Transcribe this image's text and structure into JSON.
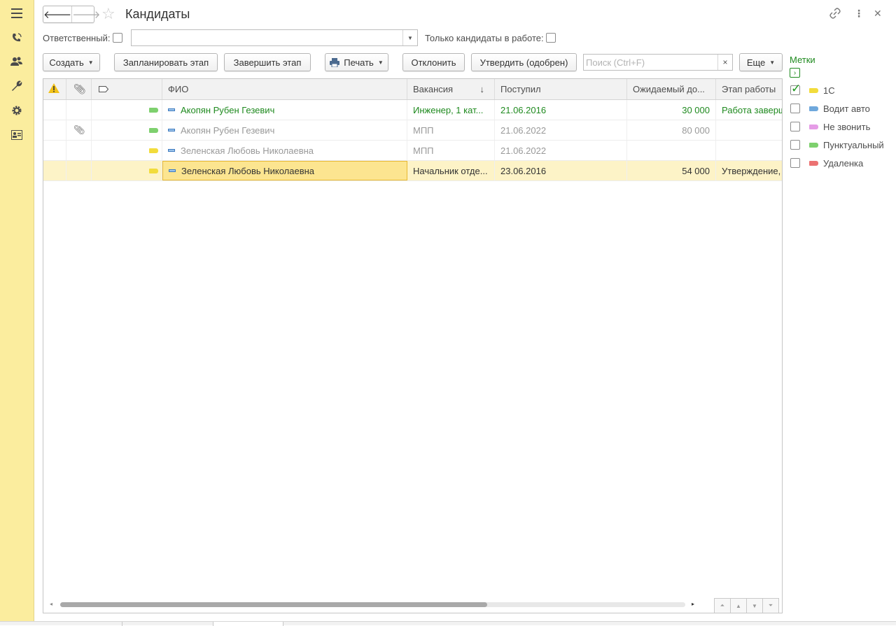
{
  "window": {
    "title": "Кандидаты"
  },
  "colors": {
    "tag_yellow": "#f2dc3c",
    "tag_blue": "#6fa8dc",
    "tag_pink": "#e59ce6",
    "tag_green": "#7ed06e",
    "tag_red": "#ec7272",
    "green_text": "#1f8a1f"
  },
  "filters": {
    "responsible_label": "Ответственный:",
    "only_active_label": "Только кандидаты в работе:",
    "responsible_value": ""
  },
  "toolbar": {
    "create": "Создать",
    "plan_stage": "Запланировать этап",
    "finish_stage": "Завершить этап",
    "print": "Печать",
    "reject": "Отклонить",
    "approve": "Утвердить (одобрен)",
    "search_placeholder": "Поиск (Ctrl+F)",
    "more": "Еще"
  },
  "table": {
    "columns": [
      "ФИО",
      "Вакансия",
      "Поступил",
      "Ожидаемый до...",
      "Этап работы"
    ],
    "sort_indicator": "↓",
    "rows": [
      {
        "fio": "Акопян Рубен Гезевич",
        "vacancy": "Инженер, 1 кат...",
        "date": "21.06.2016",
        "salary": "30 000",
        "stage": "Работа завершена",
        "style": "green",
        "attach": false,
        "tags": [
          "green",
          "yellow"
        ]
      },
      {
        "fio": "Акопян Рубен Гезевич",
        "vacancy": "МПП",
        "date": "21.06.2022",
        "salary": "80 000",
        "stage": "",
        "style": "grey",
        "attach": true,
        "tags": [
          "green",
          "yellow"
        ]
      },
      {
        "fio": "Зеленская Любовь Николаевна",
        "vacancy": "МПП",
        "date": "21.06.2022",
        "salary": "",
        "stage": "",
        "style": "grey",
        "attach": false,
        "tags": [
          "yellow",
          "blue",
          "red"
        ]
      },
      {
        "fio": "Зеленская Любовь Николаевна",
        "vacancy": "Начальник отде...",
        "date": "23.06.2016",
        "salary": "54 000",
        "stage": "Утверждение, ...",
        "style": "dark",
        "attach": false,
        "tags": [
          "yellow",
          "blue",
          "red"
        ],
        "selected": true
      }
    ]
  },
  "tags_panel": {
    "title": "Метки",
    "items": [
      {
        "label": "1С",
        "color": "yellow",
        "checked": true
      },
      {
        "label": "Водит авто",
        "color": "blue",
        "checked": false
      },
      {
        "label": "Не звонить",
        "color": "pink",
        "checked": false
      },
      {
        "label": "Пунктуальный",
        "color": "green",
        "checked": false
      },
      {
        "label": "Удаленка",
        "color": "red",
        "checked": false
      }
    ]
  }
}
